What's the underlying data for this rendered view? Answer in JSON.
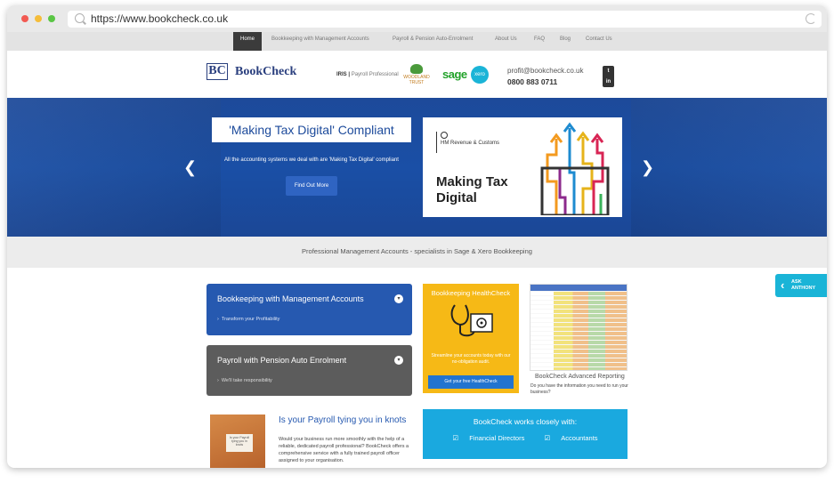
{
  "browser": {
    "url": "https://www.bookcheck.co.uk"
  },
  "nav": {
    "items": [
      "Home",
      "Bookkeeping with Management Accounts",
      "Payroll & Pension Auto-Enrolment",
      "About Us",
      "FAQ",
      "Blog",
      "Contact Us"
    ],
    "active": "Home"
  },
  "header": {
    "logo_mark": "BC",
    "logo_text": "BookCheck",
    "partners": {
      "iris": "IRIS",
      "iris_sub": "Payroll Professional",
      "woodland": "WOODLAND TRUST",
      "sage": "sage",
      "xero": "xero"
    },
    "email": "profit@bookcheck.co.uk",
    "phone": "0800 883 0711",
    "social": [
      "twitter-icon",
      "linkedin-icon"
    ]
  },
  "hero": {
    "title": "'Making Tax Digital' Compliant",
    "subtitle": "All the accounting systems we deal with are 'Making Tax Digital' compliant",
    "button": "Find Out More",
    "card": {
      "hmrc": "HM Revenue & Customs",
      "headline": "Making Tax Digital"
    }
  },
  "tagline": "Professional Management Accounts - specialists in Sage & Xero Bookkeeping",
  "services": [
    {
      "title": "Bookkeeping with Management Accounts",
      "item": "Transform your Profitability",
      "color": "#2659b0"
    },
    {
      "title": "Payroll with Pension Auto Enrolment",
      "item": "We'll take responsibility",
      "color": "#5c5c5c"
    }
  ],
  "payroll_article": {
    "title": "Is your Payroll tying you in knots",
    "thumb_note": "Is your Payroll tying you in knots",
    "body": "Would your business run more smoothly with the help of a reliable, dedicated payroll professional? BookCheck offers a comprehensive service with a fully trained payroll officer assigned to your organisation."
  },
  "healthcheck": {
    "title": "Bookkeeping HealthCheck",
    "body": "Streamline your accounts today with our no-obligation audit.",
    "button": "Get your free HealthCheck",
    "color": "#f6b916"
  },
  "advanced": {
    "title": "BookCheck Advanced Reporting",
    "body": "Do you have the information you need to run your business?"
  },
  "works_with": {
    "title": "BookCheck works closely with:",
    "items": [
      "Financial Directors",
      "Accountants"
    ]
  },
  "ask": {
    "line1": "ASK",
    "line2": "ANTHONY"
  }
}
